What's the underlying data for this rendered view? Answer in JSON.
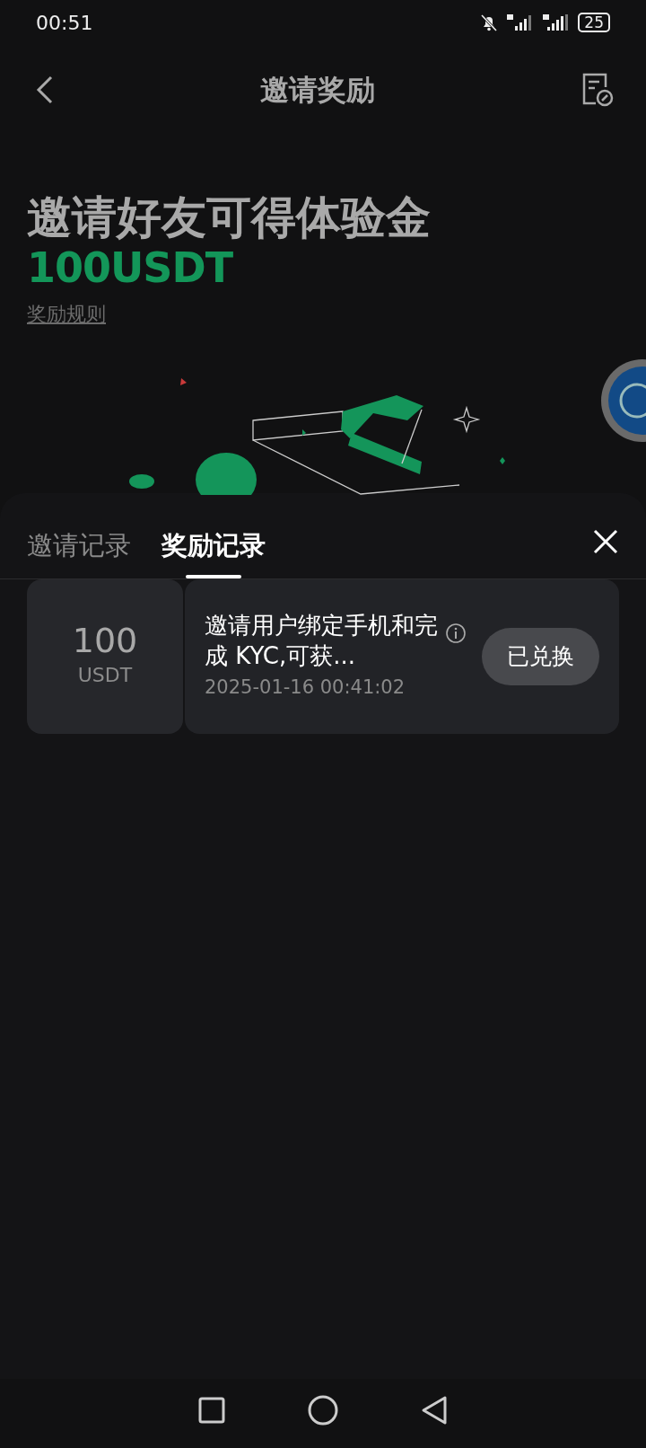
{
  "status_bar": {
    "time": "00:51",
    "battery": "25"
  },
  "header": {
    "title": "邀请奖励"
  },
  "hero": {
    "headline": "邀请好友可得体验金",
    "amount": "100USDT",
    "rules_link": "奖励规则"
  },
  "sheet": {
    "tabs": [
      {
        "label": "邀请记录",
        "selected": false
      },
      {
        "label": "奖励记录",
        "selected": true
      }
    ],
    "records": [
      {
        "amount": "100",
        "unit": "USDT",
        "description": "邀请用户绑定手机和完成 KYC,可获...",
        "time": "2025-01-16 00:41:02",
        "status": "已兑换"
      }
    ]
  }
}
